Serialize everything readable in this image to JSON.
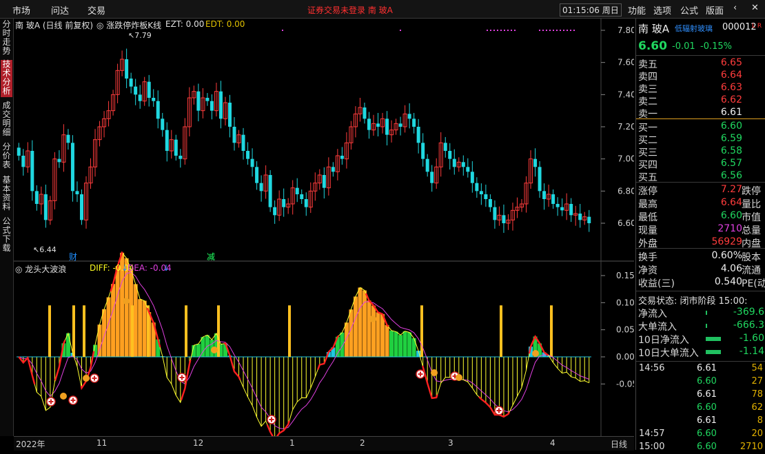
{
  "topbar": {
    "menu": [
      "市场",
      "问达",
      "交易"
    ],
    "center_text": "证券交易未登录  南 玻A",
    "clock": "01:15:06 周日",
    "right_menu": [
      "功能",
      "选项",
      "公式",
      "版面"
    ]
  },
  "sidetabs": [
    "分时走势",
    "技术分析",
    "成交明细",
    "分价表",
    "基本资料",
    "公式下载"
  ],
  "upper_chart": {
    "stock": "南 玻A (日线 前复权)",
    "indicator": "涨跌停炸板K线",
    "ezt": "EZT: 0.00",
    "edt": "EDT: 0.00",
    "y_ticks": [
      "7.80",
      "7.60",
      "7.40",
      "7.20",
      "7.00",
      "6.80",
      "6.60"
    ],
    "high_label": "7.79",
    "low_label": "6.44",
    "marker_cai": "财",
    "marker_jian": "减"
  },
  "lower_chart": {
    "name": "龙头大波浪",
    "diff": "DIFF: -0.04",
    "dea": "DEA: -0.04",
    "y_ticks": [
      "0.15",
      "0.10",
      "0.05",
      "0.00",
      "-0.05"
    ]
  },
  "x_axis": {
    "labels": [
      "2022年",
      "11",
      "12",
      "1",
      "2",
      "3",
      "4"
    ],
    "period": "日线"
  },
  "quote": {
    "name": "南 玻A",
    "tag": "低辐射玻璃",
    "code": "000012",
    "flags": "L R",
    "price": "6.60",
    "change": "-0.01",
    "pct": "-0.15%",
    "asks": [
      {
        "label": "卖五",
        "price": "6.65"
      },
      {
        "label": "卖四",
        "price": "6.64"
      },
      {
        "label": "卖三",
        "price": "6.63"
      },
      {
        "label": "卖二",
        "price": "6.62"
      },
      {
        "label": "卖一",
        "price": "6.61"
      }
    ],
    "bids": [
      {
        "label": "买一",
        "price": "6.60"
      },
      {
        "label": "买二",
        "price": "6.59"
      },
      {
        "label": "买三",
        "price": "6.58"
      },
      {
        "label": "买四",
        "price": "6.57"
      },
      {
        "label": "买五",
        "price": "6.56"
      }
    ],
    "stats": [
      {
        "k": "涨停",
        "v": "7.27",
        "k2": "跌停"
      },
      {
        "k": "最高",
        "v": "6.64",
        "k2": "量比"
      },
      {
        "k": "最低",
        "v": "6.60",
        "k2": "市值"
      },
      {
        "k": "现量",
        "v": "2710",
        "k2": "总量"
      },
      {
        "k": "外盘",
        "v": "56929",
        "k2": "内盘"
      }
    ],
    "stats2": [
      {
        "k": "换手",
        "v": "0.60%",
        "k2": "股本"
      },
      {
        "k": "净资",
        "v": "4.06",
        "k2": "流通"
      },
      {
        "k": "收益(三)",
        "v": "0.540",
        "k2": "PE(动)"
      }
    ],
    "status": "交易状态: 闭市阶段 15:00:",
    "flows": [
      {
        "k": "净流入",
        "v": "-369.6"
      },
      {
        "k": "大单流入",
        "v": "-666.3"
      },
      {
        "k": "10日净流入",
        "v": "-1.60"
      },
      {
        "k": "10日大单流入",
        "v": "-1.14"
      }
    ],
    "trades": [
      {
        "t": "14:56",
        "p": "6.61",
        "q": "54"
      },
      {
        "t": "",
        "p": "6.60",
        "q": "27"
      },
      {
        "t": "",
        "p": "6.61",
        "q": "78"
      },
      {
        "t": "",
        "p": "6.60",
        "q": "62"
      },
      {
        "t": "",
        "p": "6.61",
        "q": "8"
      },
      {
        "t": "14:57",
        "p": "6.60",
        "q": "20"
      },
      {
        "t": "15:00",
        "p": "6.60",
        "q": "2710"
      }
    ]
  },
  "chart_data": {
    "type": "candlestick",
    "closes": [
      7.02,
      6.95,
      7.05,
      6.8,
      6.72,
      6.78,
      6.62,
      6.74,
      7.0,
      6.98,
      7.15,
      7.1,
      6.8,
      6.78,
      6.62,
      6.85,
      6.95,
      7.12,
      7.2,
      7.25,
      7.3,
      7.4,
      7.55,
      7.62,
      7.5,
      7.45,
      7.4,
      7.36,
      7.48,
      7.38,
      7.36,
      7.25,
      7.18,
      7.05,
      7.12,
      7.02,
      7.0,
      7.2,
      7.38,
      7.42,
      7.3,
      7.38,
      7.36,
      7.3,
      7.42,
      7.25,
      7.35,
      7.2,
      7.1,
      7.15,
      7.05,
      7.0,
      6.95,
      6.85,
      6.8,
      6.9,
      6.7,
      6.65,
      6.75,
      6.7,
      6.72,
      6.82,
      6.78,
      6.75,
      6.7,
      6.8,
      6.85,
      6.9,
      6.82,
      6.95,
      6.92,
      7.02,
      7.0,
      7.1,
      7.2,
      7.28,
      7.32,
      7.25,
      7.18,
      7.22,
      7.2,
      7.25,
      7.15,
      7.18,
      7.22,
      7.2,
      7.28,
      7.25,
      7.2,
      7.1,
      7.0,
      6.92,
      6.85,
      6.95,
      7.1,
      7.05,
      7.0,
      6.95,
      6.98,
      6.95,
      6.92,
      6.85,
      6.8,
      6.78,
      6.75,
      6.7,
      6.62,
      6.65,
      6.6,
      6.62,
      6.68,
      6.7,
      6.72,
      6.85,
      7.0,
      6.95,
      6.8,
      6.75,
      6.78,
      6.72,
      6.7,
      6.68,
      6.72,
      6.65,
      6.66,
      6.62,
      6.64,
      6.6
    ],
    "ylim": [
      6.44,
      7.79
    ]
  }
}
